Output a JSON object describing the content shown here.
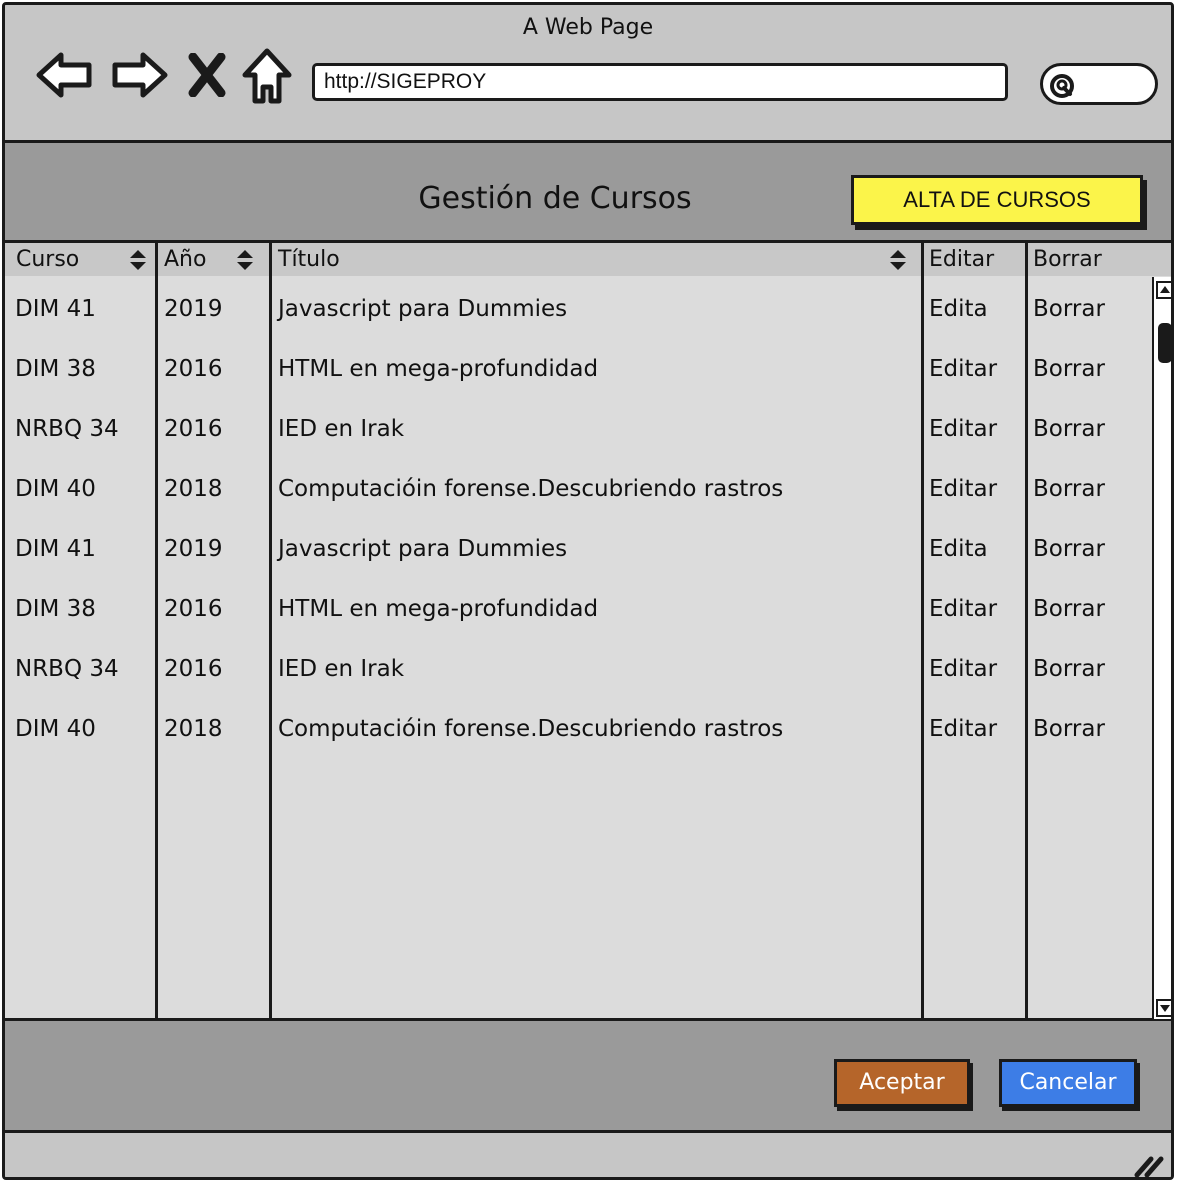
{
  "browser": {
    "title": "A Web Page",
    "url": "http://SIGEPROY"
  },
  "page": {
    "heading": "Gestión de Cursos",
    "alta_button": "ALTA DE CURSOS"
  },
  "table": {
    "headers": {
      "curso": "Curso",
      "anio": "Año",
      "titulo": "Título",
      "editar": "Editar",
      "borrar": "Borrar"
    },
    "rows": [
      {
        "curso": "DIM 41",
        "anio": "2019",
        "titulo": "Javascript para Dummies",
        "editar": "Edita",
        "borrar": "Borrar"
      },
      {
        "curso": "DIM 38",
        "anio": "2016",
        "titulo": "HTML en mega-profundidad",
        "editar": "Editar",
        "borrar": "Borrar"
      },
      {
        "curso": "NRBQ 34",
        "anio": "2016",
        "titulo": "IED en Irak",
        "editar": "Editar",
        "borrar": "Borrar"
      },
      {
        "curso": "DIM 40",
        "anio": "2018",
        "titulo": "Computacióin forense.Descubriendo rastros",
        "editar": "Editar",
        "borrar": "Borrar"
      },
      {
        "curso": "DIM 41",
        "anio": "2019",
        "titulo": "Javascript para Dummies",
        "editar": "Edita",
        "borrar": "Borrar"
      },
      {
        "curso": "DIM 38",
        "anio": "2016",
        "titulo": "HTML en mega-profundidad",
        "editar": "Editar",
        "borrar": "Borrar"
      },
      {
        "curso": "NRBQ 34",
        "anio": "2016",
        "titulo": "IED en Irak",
        "editar": "Editar",
        "borrar": "Borrar"
      },
      {
        "curso": "DIM 40",
        "anio": "2018",
        "titulo": "Computacióin forense.Descubriendo rastros",
        "editar": "Editar",
        "borrar": "Borrar"
      }
    ]
  },
  "footer": {
    "accept": "Aceptar",
    "cancel": "Cancelar"
  },
  "colors": {
    "alta_button": "#fbf44a",
    "accept_button": "#b5652a",
    "cancel_button": "#3d7de6"
  },
  "icons": [
    "back-arrow-icon",
    "forward-arrow-icon",
    "close-icon",
    "home-icon",
    "search-icon",
    "sort-icon",
    "resize-grip-icon"
  ]
}
